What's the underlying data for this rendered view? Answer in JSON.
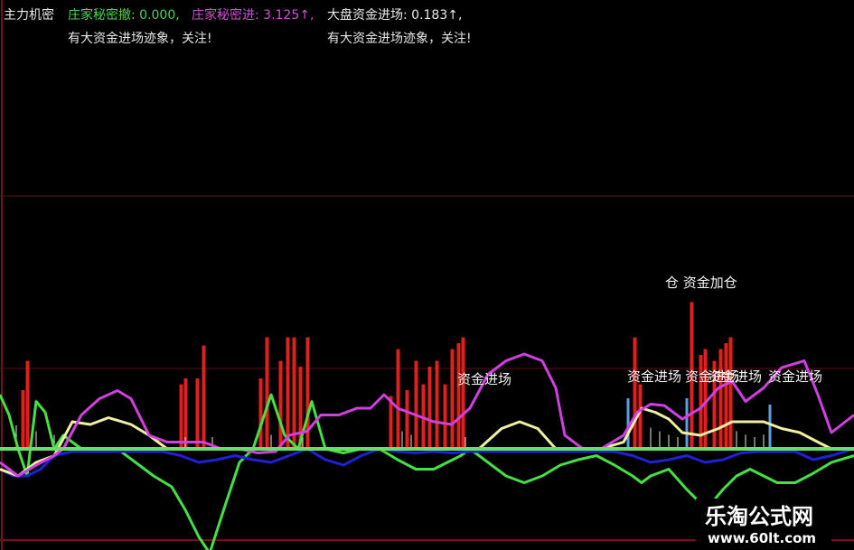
{
  "indicator_title": "主力机密",
  "header": [
    {
      "label": "庄家秘密撤: 0.000,",
      "color": "#4fd24f"
    },
    {
      "label": "庄家秘密进: 3.125↑,",
      "color": "#d24fd2"
    },
    {
      "label": "大盘资金进场: 0.183↑,",
      "color": "#e8e8e8"
    }
  ],
  "notices": [
    "有大资金进场迹象，关注!",
    "有大资金进场迹象，关注!"
  ],
  "annotations": [
    {
      "text": "资金进场"
    },
    {
      "text": "资金进场"
    },
    {
      "text": "资金进场"
    },
    {
      "text": "资金进场"
    },
    {
      "text": "资金进场"
    },
    {
      "text": "仓 资金加仓"
    }
  ],
  "watermark": {
    "title": "乐淘公式网",
    "url": "www.60lt.com"
  },
  "colors": {
    "background": "#000000",
    "frame": "#7a0f1a",
    "red_bars": "#e0201c",
    "blue_ticks": "#5aa0e0",
    "magenta": "#d040e0",
    "yellow": "#f0f0a0",
    "green": "#44e044",
    "blue": "#2020d8",
    "baseline": "#66e066",
    "white_ticks": "#e8e8e8"
  },
  "chart_data": {
    "type": "line",
    "ylim": [
      -100,
      100
    ],
    "series": [
      {
        "key": "magenta",
        "values": [
          [
            0,
            -10
          ],
          [
            20,
            -20
          ],
          [
            40,
            -12
          ],
          [
            60,
            -5
          ],
          [
            70,
            0
          ],
          [
            90,
            25
          ],
          [
            110,
            37
          ],
          [
            130,
            43
          ],
          [
            145,
            37
          ],
          [
            165,
            10
          ],
          [
            185,
            5
          ],
          [
            205,
            5
          ],
          [
            225,
            5
          ],
          [
            245,
            0
          ],
          [
            265,
            0
          ],
          [
            285,
            -3
          ],
          [
            305,
            -2
          ],
          [
            320,
            10
          ],
          [
            340,
            13
          ],
          [
            355,
            25
          ],
          [
            375,
            25
          ],
          [
            395,
            30
          ],
          [
            410,
            30
          ],
          [
            425,
            40
          ],
          [
            440,
            30
          ],
          [
            460,
            25
          ],
          [
            480,
            20
          ],
          [
            500,
            18
          ],
          [
            520,
            30
          ],
          [
            540,
            55
          ],
          [
            560,
            65
          ],
          [
            580,
            70
          ],
          [
            600,
            65
          ],
          [
            615,
            45
          ],
          [
            625,
            10
          ],
          [
            645,
            0
          ],
          [
            665,
            0
          ],
          [
            690,
            10
          ],
          [
            705,
            27
          ],
          [
            720,
            33
          ],
          [
            735,
            32
          ],
          [
            755,
            22
          ],
          [
            775,
            30
          ],
          [
            795,
            45
          ],
          [
            810,
            50
          ],
          [
            825,
            35
          ],
          [
            845,
            45
          ],
          [
            865,
            60
          ],
          [
            890,
            65
          ],
          [
            905,
            40
          ],
          [
            920,
            12
          ],
          [
            945,
            25
          ]
        ]
      },
      {
        "key": "yellow",
        "values": [
          [
            0,
            -15
          ],
          [
            20,
            -20
          ],
          [
            40,
            -10
          ],
          [
            60,
            -5
          ],
          [
            80,
            20
          ],
          [
            100,
            18
          ],
          [
            120,
            23
          ],
          [
            145,
            18
          ],
          [
            165,
            10
          ],
          [
            185,
            0
          ],
          [
            205,
            0
          ],
          [
            225,
            0
          ],
          [
            245,
            0
          ],
          [
            265,
            0
          ],
          [
            285,
            0
          ],
          [
            305,
            0
          ],
          [
            320,
            0
          ],
          [
            340,
            0
          ],
          [
            355,
            0
          ],
          [
            375,
            0
          ],
          [
            395,
            0
          ],
          [
            410,
            0
          ],
          [
            430,
            0
          ],
          [
            450,
            0
          ],
          [
            470,
            0
          ],
          [
            490,
            0
          ],
          [
            510,
            0
          ],
          [
            530,
            0
          ],
          [
            555,
            15
          ],
          [
            575,
            20
          ],
          [
            595,
            15
          ],
          [
            615,
            0
          ],
          [
            645,
            0
          ],
          [
            665,
            0
          ],
          [
            690,
            5
          ],
          [
            710,
            30
          ],
          [
            725,
            27
          ],
          [
            740,
            22
          ],
          [
            755,
            12
          ],
          [
            775,
            10
          ],
          [
            795,
            15
          ],
          [
            810,
            20
          ],
          [
            825,
            20
          ],
          [
            845,
            20
          ],
          [
            865,
            15
          ],
          [
            885,
            12
          ],
          [
            905,
            5
          ],
          [
            920,
            0
          ],
          [
            945,
            0
          ]
        ]
      },
      {
        "key": "green",
        "values": [
          [
            0,
            40
          ],
          [
            10,
            25
          ],
          [
            20,
            0
          ],
          [
            30,
            -20
          ],
          [
            40,
            35
          ],
          [
            50,
            27
          ],
          [
            60,
            0
          ],
          [
            70,
            10
          ],
          [
            90,
            0
          ],
          [
            110,
            0
          ],
          [
            130,
            0
          ],
          [
            150,
            -10
          ],
          [
            170,
            -20
          ],
          [
            190,
            -28
          ],
          [
            205,
            -45
          ],
          [
            220,
            -65
          ],
          [
            232,
            -77
          ],
          [
            250,
            -40
          ],
          [
            265,
            -10
          ],
          [
            280,
            0
          ],
          [
            300,
            40
          ],
          [
            315,
            10
          ],
          [
            330,
            0
          ],
          [
            345,
            35
          ],
          [
            360,
            0
          ],
          [
            380,
            -3
          ],
          [
            400,
            0
          ],
          [
            420,
            0
          ],
          [
            440,
            -8
          ],
          [
            460,
            -15
          ],
          [
            480,
            -15
          ],
          [
            495,
            -10
          ],
          [
            510,
            -5
          ],
          [
            520,
            0
          ],
          [
            540,
            -10
          ],
          [
            560,
            -20
          ],
          [
            580,
            -25
          ],
          [
            600,
            -20
          ],
          [
            620,
            -12
          ],
          [
            640,
            -8
          ],
          [
            660,
            -5
          ],
          [
            680,
            -12
          ],
          [
            700,
            -20
          ],
          [
            710,
            -25
          ],
          [
            720,
            -20
          ],
          [
            740,
            -15
          ],
          [
            760,
            -30
          ],
          [
            775,
            -40
          ],
          [
            790,
            -38
          ],
          [
            800,
            -30
          ],
          [
            815,
            -20
          ],
          [
            830,
            -15
          ],
          [
            845,
            -20
          ],
          [
            860,
            -25
          ],
          [
            880,
            -25
          ],
          [
            900,
            -18
          ],
          [
            920,
            -10
          ],
          [
            945,
            -5
          ]
        ]
      },
      {
        "key": "blue",
        "values": [
          [
            0,
            -15
          ],
          [
            15,
            -20
          ],
          [
            30,
            -20
          ],
          [
            45,
            -15
          ],
          [
            60,
            -5
          ],
          [
            80,
            -2
          ],
          [
            100,
            -2
          ],
          [
            120,
            -2
          ],
          [
            140,
            -2
          ],
          [
            160,
            -2
          ],
          [
            180,
            -2
          ],
          [
            200,
            -5
          ],
          [
            220,
            -10
          ],
          [
            240,
            -8
          ],
          [
            260,
            -5
          ],
          [
            280,
            -8
          ],
          [
            300,
            -10
          ],
          [
            320,
            -5
          ],
          [
            340,
            0
          ],
          [
            360,
            -8
          ],
          [
            380,
            -12
          ],
          [
            400,
            -5
          ],
          [
            420,
            0
          ],
          [
            440,
            -2
          ],
          [
            460,
            -3
          ],
          [
            480,
            -2
          ],
          [
            500,
            -3
          ],
          [
            520,
            -2
          ],
          [
            540,
            -2
          ],
          [
            560,
            -2
          ],
          [
            580,
            -2
          ],
          [
            600,
            -2
          ],
          [
            620,
            -2
          ],
          [
            640,
            -2
          ],
          [
            660,
            -2
          ],
          [
            680,
            -2
          ],
          [
            700,
            -5
          ],
          [
            720,
            -10
          ],
          [
            740,
            -8
          ],
          [
            760,
            -5
          ],
          [
            780,
            -10
          ],
          [
            800,
            -8
          ],
          [
            820,
            -3
          ],
          [
            840,
            -2
          ],
          [
            860,
            -2
          ],
          [
            880,
            -2
          ],
          [
            900,
            -8
          ],
          [
            920,
            -5
          ],
          [
            945,
            0
          ]
        ]
      }
    ],
    "red_bars": [
      [
        25,
        50
      ],
      [
        30,
        75
      ],
      [
        200,
        55
      ],
      [
        205,
        60
      ],
      [
        218,
        60
      ],
      [
        225,
        88
      ],
      [
        288,
        60
      ],
      [
        295,
        95
      ],
      [
        310,
        75
      ],
      [
        318,
        95
      ],
      [
        325,
        95
      ],
      [
        332,
        70
      ],
      [
        340,
        95
      ],
      [
        432,
        45
      ],
      [
        440,
        85
      ],
      [
        450,
        50
      ],
      [
        460,
        75
      ],
      [
        468,
        55
      ],
      [
        475,
        70
      ],
      [
        483,
        75
      ],
      [
        492,
        55
      ],
      [
        500,
        85
      ],
      [
        507,
        90
      ],
      [
        512,
        95
      ],
      [
        702,
        95
      ],
      [
        708,
        55
      ],
      [
        765,
        125
      ],
      [
        775,
        80
      ],
      [
        780,
        85
      ],
      [
        790,
        75
      ],
      [
        797,
        85
      ],
      [
        803,
        90
      ],
      [
        808,
        95
      ]
    ],
    "blue_ticks": [
      [
        695,
        40
      ],
      [
        760,
        40
      ],
      [
        852,
        35
      ]
    ],
    "white_ticks": [
      [
        18,
        20
      ],
      [
        40,
        15
      ],
      [
        60,
        12
      ],
      [
        205,
        10
      ],
      [
        235,
        10
      ],
      [
        300,
        12
      ],
      [
        335,
        10
      ],
      [
        445,
        15
      ],
      [
        455,
        12
      ],
      [
        515,
        10
      ],
      [
        720,
        18
      ],
      [
        730,
        15
      ],
      [
        740,
        12
      ],
      [
        750,
        10
      ],
      [
        815,
        15
      ],
      [
        825,
        12
      ],
      [
        835,
        10
      ],
      [
        845,
        12
      ]
    ]
  }
}
